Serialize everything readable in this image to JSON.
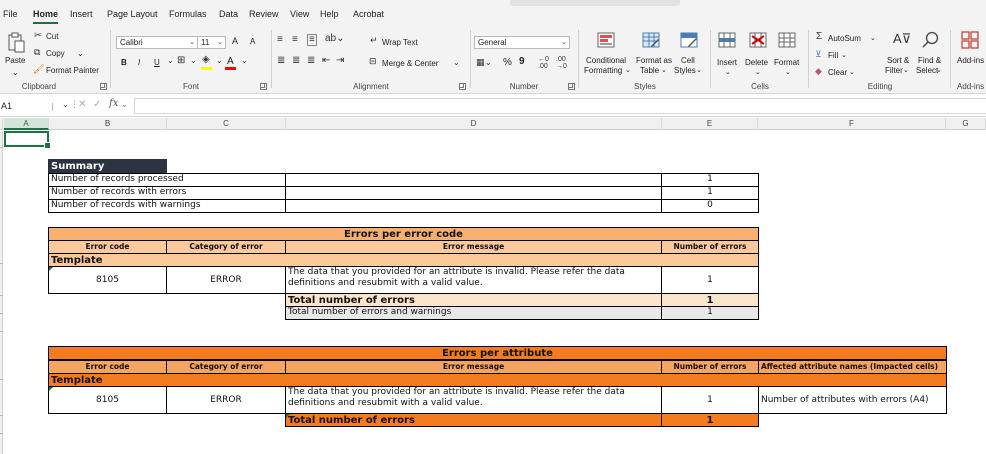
{
  "menu": {
    "tabs": [
      "File",
      "Home",
      "Insert",
      "Page Layout",
      "Formulas",
      "Data",
      "Review",
      "View",
      "Help",
      "Acrobat"
    ],
    "active": "Home"
  },
  "ribbon": {
    "clipboard": {
      "paste": "Paste",
      "cut": "Cut",
      "copy": "Copy",
      "format_painter": "Format Painter",
      "label": "Clipboard"
    },
    "font": {
      "name": "Calibri",
      "size": "11",
      "label": "Font",
      "bold": "B",
      "italic": "I",
      "underline": "U",
      "grow": "A",
      "shrink": "A"
    },
    "alignment": {
      "wrap_text": "Wrap Text",
      "merge_center": "Merge & Center",
      "label": "Alignment"
    },
    "number": {
      "format": "General",
      "percent": "%",
      "comma": "9",
      "label": "Number"
    },
    "styles": {
      "conditional": "Conditional",
      "conditional2": "Formatting",
      "format_as": "Format as",
      "format_as2": "Table",
      "cell": "Cell",
      "cell2": "Styles",
      "label": "Styles"
    },
    "cells": {
      "insert": "Insert",
      "delete": "Delete",
      "format": "Format",
      "label": "Cells"
    },
    "editing": {
      "autosum": "AutoSum",
      "fill": "Fill",
      "clear": "Clear",
      "sort": "Sort &",
      "sort2": "Filter",
      "find": "Find &",
      "find2": "Select",
      "label": "Editing"
    },
    "addins": {
      "name": "Add-ins",
      "label": "Add-ins"
    },
    "colors": {
      "highlight": "#ffff00",
      "font_color": "#ff0000"
    }
  },
  "formula_bar": {
    "name_box": "A1",
    "fx": "fx",
    "value": ""
  },
  "columns": [
    "A",
    "B",
    "C",
    "D",
    "E",
    "F",
    "G"
  ],
  "sheet": {
    "summary": {
      "title": "Summary",
      "rows": [
        {
          "label": "Number of records processed",
          "value": "1"
        },
        {
          "label": "Number of records with errors",
          "value": "1"
        },
        {
          "label": "Number of records with warnings",
          "value": "0"
        }
      ]
    },
    "errors_per_code": {
      "title": "Errors per error code",
      "headers": {
        "code": "Error code",
        "category": "Category of error",
        "message": "Error message",
        "count": "Number of errors"
      },
      "template_label": "Template",
      "row": {
        "code": "8105",
        "category": "ERROR",
        "message": "The data that you provided for an attribute is invalid. Please refer the data definitions and resubmit with a valid value.",
        "count": "1"
      },
      "total_label": "Total number of errors",
      "total_value": "1",
      "total_warn_label": "Total number of errors and warnings",
      "total_warn_value": "1"
    },
    "errors_per_attribute": {
      "title": "Errors per attribute",
      "headers": {
        "code": "Error code",
        "category": "Category of error",
        "message": "Error message",
        "count": "Number of errors",
        "affected": "Affected attribute names (Impacted cells)"
      },
      "template_label": "Template",
      "row": {
        "code": "8105",
        "category": "ERROR",
        "message": "The data that you provided for an attribute is invalid. Please refer the data definitions and resubmit with a valid value.",
        "count": "1",
        "affected": "Number of attributes with errors (A4)"
      },
      "total_label": "Total number of errors",
      "total_value": "1"
    },
    "colors": {
      "summary_header_bg": "#2b3340",
      "code_title_bg": "#f8b070",
      "code_header_bg": "#fbc99a",
      "code_total_bg": "#fde5cc",
      "code_total_warn_bg": "#e8e8e8",
      "attr_title_bg": "#f47c20",
      "attr_header_bg": "#f7a462",
      "grid_green": "#1e7145"
    }
  }
}
